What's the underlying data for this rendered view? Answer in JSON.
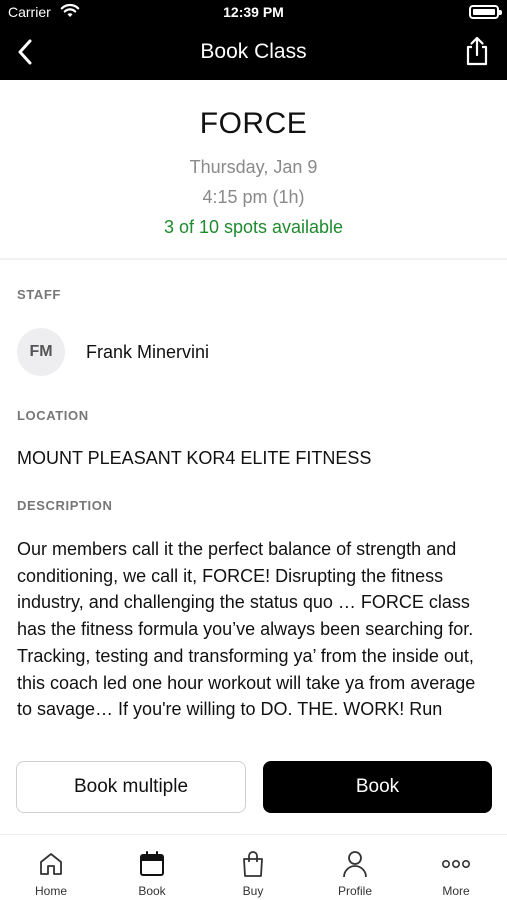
{
  "status_bar": {
    "carrier": "Carrier",
    "time": "12:39 PM"
  },
  "nav": {
    "title": "Book Class"
  },
  "class_info": {
    "name": "FORCE",
    "date": "Thursday, Jan 9",
    "time": "4:15 pm (1h)",
    "spots": "3 of 10 spots available",
    "spots_color": "#1f8a2e"
  },
  "staff": {
    "label": "STAFF",
    "initials": "FM",
    "name": "Frank Minervini"
  },
  "location": {
    "label": "LOCATION",
    "name": "MOUNT PLEASANT KOR4 ELITE FITNESS"
  },
  "description": {
    "label": "DESCRIPTION",
    "text": "Our members call it the perfect balance of strength and conditioning, we call it, FORCE! Disrupting the fitness industry, and challenging the status quo … FORCE class has the fitness formula you’ve always been searching for. Tracking, testing and transforming ya’ from the inside out, this coach led one hour workout will take ya from average to savage… If you're willing to DO. THE. WORK! Run"
  },
  "actions": {
    "book_multiple": "Book multiple",
    "book": "Book"
  },
  "tabs": [
    {
      "label": "Home",
      "icon": "home-icon"
    },
    {
      "label": "Book",
      "icon": "calendar-icon"
    },
    {
      "label": "Buy",
      "icon": "shopping-bag-icon"
    },
    {
      "label": "Profile",
      "icon": "person-icon"
    },
    {
      "label": "More",
      "icon": "more-dots-icon"
    }
  ],
  "colors": {
    "accent": "#000000",
    "available": "#1f8a2e",
    "muted": "#8a8a8a"
  }
}
